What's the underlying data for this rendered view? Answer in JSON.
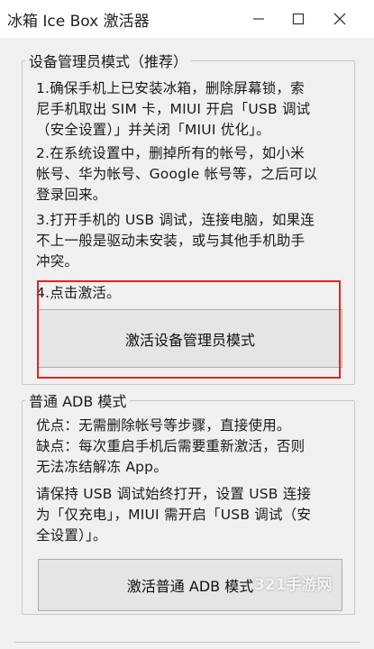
{
  "window": {
    "title": "冰箱 Ice Box 激活器"
  },
  "device_admin": {
    "legend": "设备管理员模式（推荐）",
    "step1": [
      "1.确保手机上已安装冰箱，删除屏幕锁，索",
      "尼手机取出 SIM 卡，MIUI 开启「USB 调试",
      "（安全设置）」并关闭「MIUI 优化」。"
    ],
    "step2": [
      "2.在系统设置中，删掉所有的帐号，如小米",
      "帐号、华为帐号、Google 帐号等，之后可以",
      "登录回来。"
    ],
    "step3": [
      "3.打开手机的 USB 调试，连接电脑，如果连",
      "不上一般是驱动未安装，或与其他手机助手",
      "冲突。"
    ],
    "step4": "4.点击激活。",
    "button_label": "激活设备管理员模式"
  },
  "adb_mode": {
    "legend": "普通 ADB 模式",
    "pros_cons": [
      "优点：无需删除帐号等步骤，直接使用。",
      "缺点：每次重启手机后需要重新激活，否则",
      "无法冻结解冻 App。"
    ],
    "usb_note": [
      "请保持 USB 调试始终打开，设置 USB 连接",
      "为「仅充电」，MIUI 需开启「USB 调试（安",
      "全设置）」。"
    ],
    "button_label": "激活普通 ADB 模式"
  },
  "watermark": "321手游网",
  "colors": {
    "highlight": "#e02424",
    "window_bg": "#f0f0f0",
    "button_bg": "#e5e5e5"
  },
  "icons": [
    "minimize-icon",
    "maximize-icon",
    "close-icon"
  ]
}
